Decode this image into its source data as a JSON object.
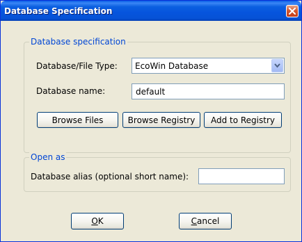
{
  "window": {
    "title": "Database Specification",
    "close_icon": "close-icon"
  },
  "db_spec": {
    "legend": "Database specification",
    "type_label": "Database/File Type:",
    "type_value": "EcoWin Database",
    "name_label": "Database name:",
    "name_value": "default",
    "browse_files": "Browse Files",
    "browse_registry": "Browse Registry",
    "add_to_registry": "Add to Registry"
  },
  "open_as": {
    "legend": "Open as",
    "alias_label": "Database alias (optional short name):",
    "alias_value": ""
  },
  "footer": {
    "ok_mnemonic": "O",
    "ok_rest": "K",
    "cancel_mnemonic": "C",
    "cancel_rest": "ancel"
  },
  "colors": {
    "titlebar": "#0654dd",
    "legend_text": "#0046d5",
    "dialog_bg": "#ece9d8"
  }
}
